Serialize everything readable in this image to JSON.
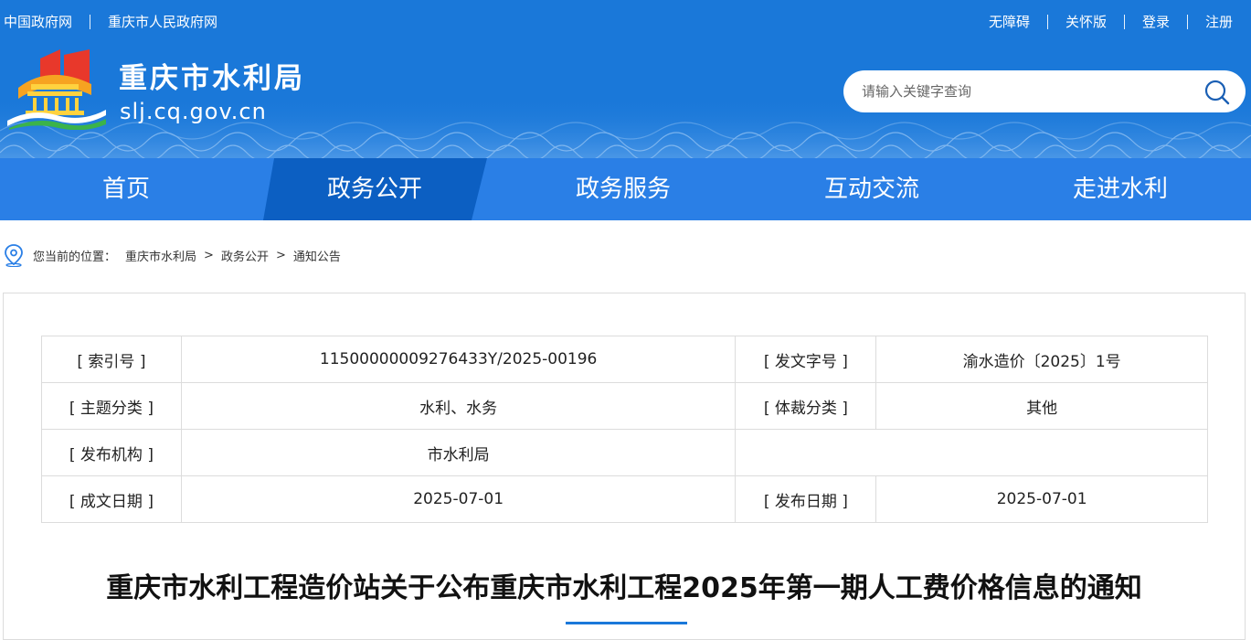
{
  "top_links": {
    "left": [
      "中国政府网",
      "重庆市人民政府网"
    ],
    "right": [
      "无障碍",
      "关怀版",
      "登录",
      "注册"
    ]
  },
  "site": {
    "title": "重庆市水利局",
    "domain": "slj.cq.gov.cn"
  },
  "search": {
    "placeholder": "请输入关键字查询"
  },
  "nav": {
    "items": [
      "首页",
      "政务公开",
      "政务服务",
      "互动交流",
      "走进水利"
    ],
    "active": "政务公开"
  },
  "breadcrumb": {
    "label": "您当前的位置：",
    "items": [
      "重庆市水利局",
      "政务公开",
      "通知公告"
    ],
    "separator": ">"
  },
  "meta": {
    "index_no_label": "[ 索引号 ]",
    "index_no": "11500000009276433Y/2025-00196",
    "doc_no_label": "[ 发文字号 ]",
    "doc_no": "渝水造价〔2025〕1号",
    "subject_label": "[ 主题分类 ]",
    "subject": "水利、水务",
    "genre_label": "[ 体裁分类 ]",
    "genre": "其他",
    "publisher_label": "[ 发布机构 ]",
    "publisher": "市水利局",
    "created_label": "[ 成文日期 ]",
    "created": "2025-07-01",
    "published_label": "[ 发布日期 ]",
    "published": "2025-07-01"
  },
  "article": {
    "title": "重庆市水利工程造价站关于公布重庆市水利工程2025年第一期人工费价格信息的通知"
  },
  "colors": {
    "header_blue": "#1a78d9",
    "nav_blue": "#2a7fe6",
    "nav_active": "#0c5fc2"
  }
}
